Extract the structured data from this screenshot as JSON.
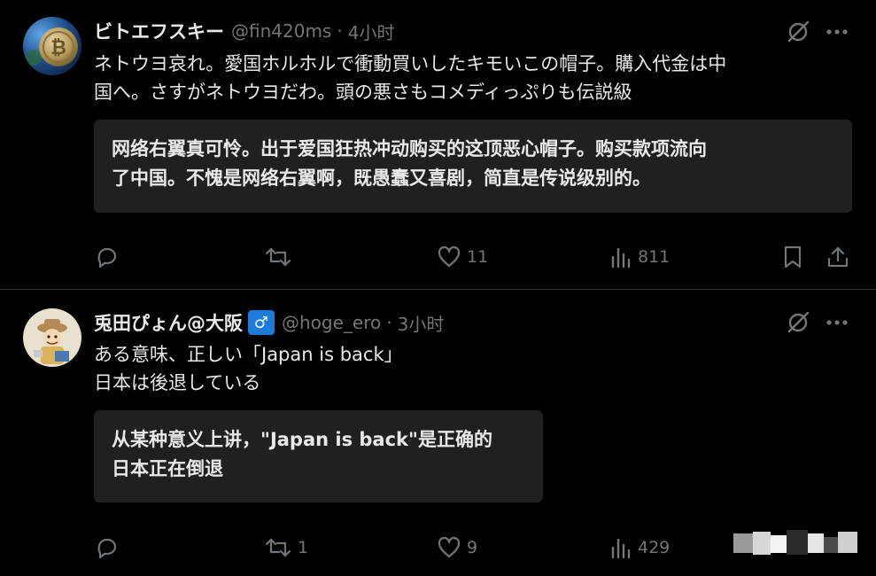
{
  "posts": [
    {
      "author": "ビトエフスキー",
      "handle": "@fin420ms",
      "dot": "·",
      "time": "4小时",
      "text_lines": [
        "ネトウヨ哀れ。愛国ホルホルで衝動買いしたキモいこの帽子。購入代金は中",
        "国へ。さすがネトウヨだわ。頭の悪さもコメディっぷりも伝説級"
      ],
      "translation_lines": [
        "网络右翼真可怜。出于爱国狂热冲动购买的这顶恶心帽子。购买款项流向",
        "了中国。不愧是网络右翼啊，既愚蠢又喜剧，简直是传说级别的。"
      ],
      "retweets": "",
      "likes": "11",
      "views": "811"
    },
    {
      "author": "兎田ぴょん@大阪",
      "badge": "♂",
      "handle": "@hoge_ero",
      "dot": "·",
      "time": "3小时",
      "text_lines": [
        "ある意味、正しい「Japan is back」",
        "日本は後退している"
      ],
      "translation_lines": [
        "从某种意义上讲，\"Japan is back\"是正确的",
        "日本正在倒退"
      ],
      "retweets": "1",
      "likes": "9",
      "views": "429"
    }
  ],
  "icons": {
    "grok": "grok-icon",
    "more": "more-icon",
    "reply": "reply-icon",
    "retweet": "retweet-icon",
    "like": "like-icon",
    "views": "views-icon",
    "bookmark": "bookmark-icon",
    "share": "share-icon"
  },
  "colors": {
    "background": "#000000",
    "text": "#e7e9ea",
    "muted": "#71767b",
    "translation_bg": "#202020",
    "divider": "#2f3336",
    "badge": "#1d7bd8"
  }
}
